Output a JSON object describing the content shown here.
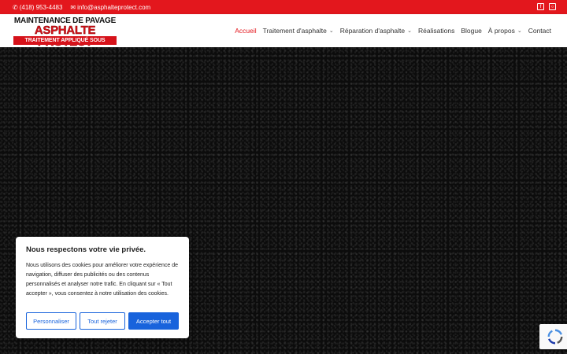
{
  "topbar": {
    "phone": "(418) 953-4483",
    "email": "info@asphalteprotect.com",
    "social": [
      "facebook-icon",
      "instagram-icon"
    ]
  },
  "logo": {
    "line1": "MAINTENANCE DE PAVAGE",
    "line2": "ASPHALTE PROTECT",
    "line3": "TRAITEMENT APPLIQUÉ SOUS PRESSION"
  },
  "nav": {
    "items": [
      {
        "label": "Accueil",
        "active": true,
        "dropdown": false
      },
      {
        "label": "Traitement d'asphalte",
        "active": false,
        "dropdown": true
      },
      {
        "label": "Réparation d'asphalte",
        "active": false,
        "dropdown": true
      },
      {
        "label": "Réalisations",
        "active": false,
        "dropdown": false
      },
      {
        "label": "Blogue",
        "active": false,
        "dropdown": false
      },
      {
        "label": "À propos",
        "active": false,
        "dropdown": true
      },
      {
        "label": "Contact",
        "active": false,
        "dropdown": false
      }
    ]
  },
  "cookie": {
    "title": "Nous respectons votre vie privée.",
    "body": "Nous utilisons des cookies pour améliorer votre expérience de navigation, diffuser des publicités ou des contenus personnalisés et analyser notre trafic. En cliquant sur « Tout accepter », vous consentez à notre utilisation des cookies.",
    "customize_label": "Personnaliser",
    "reject_label": "Tout rejeter",
    "accept_label": "Accepter tout"
  },
  "colors": {
    "brand_red": "#e3171d",
    "button_blue": "#1863dc"
  }
}
